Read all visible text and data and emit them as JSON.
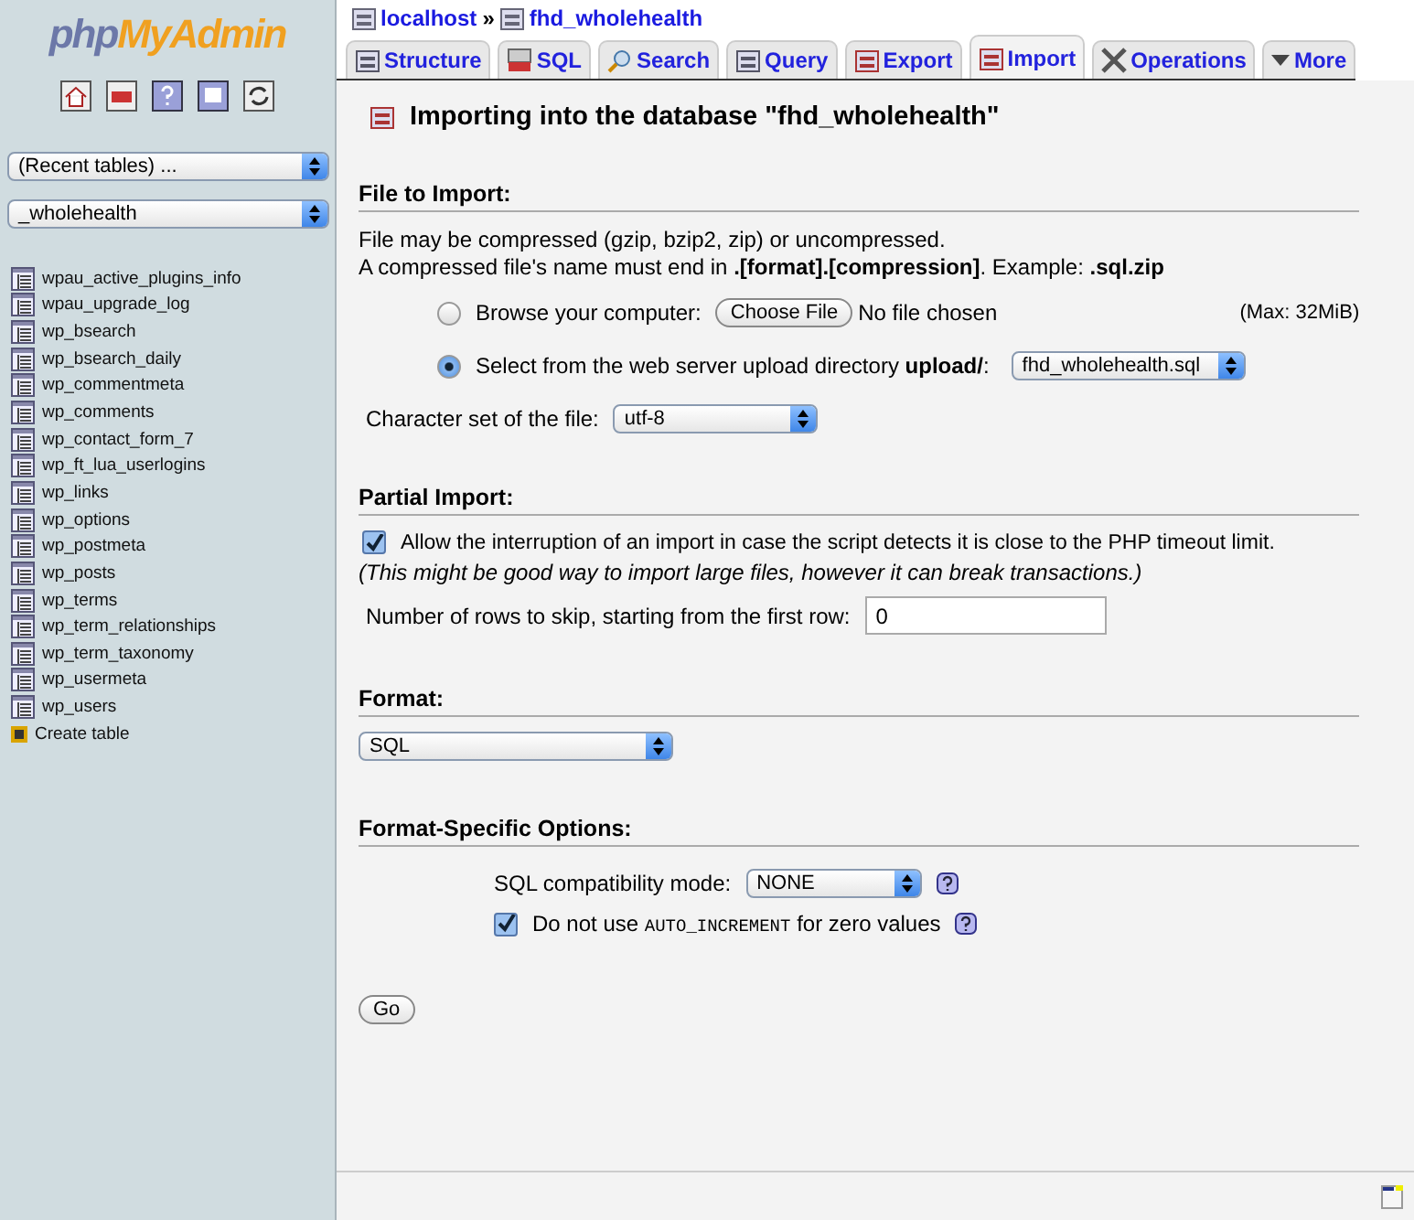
{
  "sidebar": {
    "logo": {
      "part_1": "php",
      "part_2": "MyAdmin"
    },
    "recent_select": "(Recent tables) ...",
    "database_select": "_wholehealth",
    "tables": [
      "wpau_active_plugins_info",
      "wpau_upgrade_log",
      "wp_bsearch",
      "wp_bsearch_daily",
      "wp_commentmeta",
      "wp_comments",
      "wp_contact_form_7",
      "wp_ft_lua_userlogins",
      "wp_links",
      "wp_options",
      "wp_postmeta",
      "wp_posts",
      "wp_terms",
      "wp_term_relationships",
      "wp_term_taxonomy",
      "wp_usermeta",
      "wp_users"
    ],
    "create_table": "Create table"
  },
  "breadcrumb": {
    "server": "localhost",
    "separator": "»",
    "database": "fhd_wholehealth"
  },
  "tabs": [
    {
      "label": "Structure",
      "selected": false
    },
    {
      "label": "SQL",
      "selected": false
    },
    {
      "label": "Search",
      "selected": false
    },
    {
      "label": "Query",
      "selected": false
    },
    {
      "label": "Export",
      "selected": false
    },
    {
      "label": "Import",
      "selected": true
    },
    {
      "label": "Operations",
      "selected": false
    },
    {
      "label": "More",
      "selected": false
    }
  ],
  "heading": "Importing into the database \"fhd_wholehealth\"",
  "file_to_import": {
    "title": "File to Import:",
    "note_1": "File may be compressed (gzip, bzip2, zip) or uncompressed.",
    "note_2": "A compressed file's name must end in **.[format].[compression]**. Example: **.sql.zip**",
    "browse": {
      "label": "Browse your computer:",
      "button": "Choose File",
      "status": "No file chosen",
      "max": "(Max: 32MiB)",
      "selected": false
    },
    "server_dir": {
      "label": "Select from the web server upload directory **upload/**:",
      "value": "fhd_wholehealth.sql",
      "selected": true
    },
    "charset_label": "Character set of the file:",
    "charset": "utf-8"
  },
  "partial_import": {
    "title": "Partial Import:",
    "allow_interrupt": {
      "label": "Allow the interruption of an import in case the script detects it is close to the PHP timeout limit.",
      "checked": true
    },
    "hint": "(This might be good way to import large files, however it can break transactions.)",
    "skip_label": "Number of rows to skip, starting from the first row:",
    "skip_value": "0"
  },
  "format": {
    "title": "Format:",
    "value": "SQL"
  },
  "format_options": {
    "title": "Format-Specific Options:",
    "compat_label": "SQL compatibility mode:",
    "compat_value": "NONE",
    "no_auto_increment": {
      "before": "Do not use",
      "code": "AUTO_INCREMENT",
      "after": "for zero values",
      "checked": true
    }
  },
  "go_button": "Go"
}
